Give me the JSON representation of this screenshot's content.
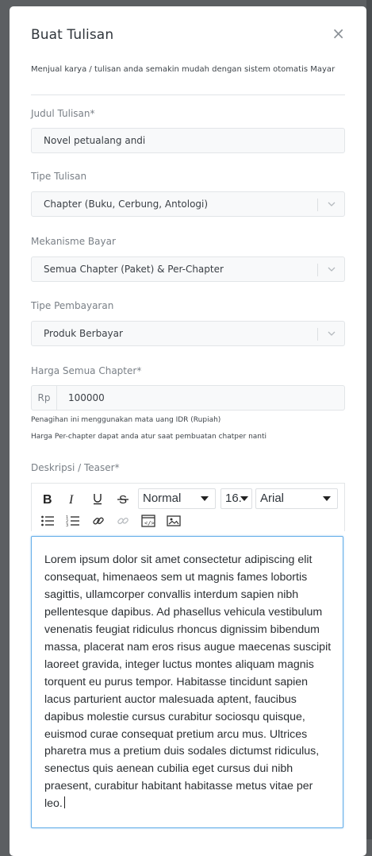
{
  "modal": {
    "title": "Buat Tulisan",
    "close_glyph": "×",
    "subtitle": "Menjual karya / tulisan anda semakin mudah dengan sistem otomatis Mayar"
  },
  "form": {
    "judul": {
      "label": "Judul Tulisan*",
      "value": "Novel petualang andi"
    },
    "tipe_tulisan": {
      "label": "Tipe Tulisan",
      "value": "Chapter (Buku, Cerbung, Antologi)"
    },
    "mekanisme_bayar": {
      "label": "Mekanisme Bayar",
      "value": "Semua Chapter (Paket) & Per-Chapter"
    },
    "tipe_pembayaran": {
      "label": "Tipe Pembayaran",
      "value": "Produk Berbayar"
    },
    "harga": {
      "label": "Harga Semua Chapter*",
      "prefix": "Rp",
      "value": "100000",
      "note1": "Penagihan ini menggunakan mata uang IDR (Rupiah)",
      "note2": "Harga Per-chapter dapat anda atur saat pembuatan chatper nanti"
    },
    "deskripsi": {
      "label": "Deskripsi / Teaser*"
    }
  },
  "editor": {
    "toolbar": {
      "format": "Normal",
      "size": "16.",
      "font": "Arial",
      "icons": [
        "bold-icon",
        "italic-icon",
        "underline-icon",
        "strikethrough-icon",
        "bullet-list-icon",
        "numbered-list-icon",
        "link-icon",
        "unlink-icon",
        "code-view-icon",
        "image-icon"
      ]
    },
    "content": "Lorem ipsum dolor sit amet consectetur adipiscing elit consequat, himenaeos sem ut magnis fames lobortis sagittis, ullamcorper convallis interdum sapien nibh pellentesque dapibus. Ad phasellus vehicula vestibulum venenatis feugiat ridiculus rhoncus dignissim bibendum massa, placerat nam eros risus augue maecenas suscipit laoreet gravida, integer luctus montes aliquam magnis torquent eu purus tempor. Habitasse tincidunt sapien lacus parturient auctor malesuada aptent, faucibus dapibus molestie cursus curabitur sociosqu quisque, euismod curae consequat pretium arcu mus. Ultrices pharetra mus a pretium duis sodales dictumst ridiculus, senectus quis aenean cubilia eget cursus dui nibh praesent, curabitur habitant habitasse metus vitae per leo."
  },
  "colors": {
    "backdrop": "#5c5f62",
    "field_bg": "#f8f9fa",
    "field_border": "#e2e5e8",
    "focus_border": "#66afe9"
  }
}
